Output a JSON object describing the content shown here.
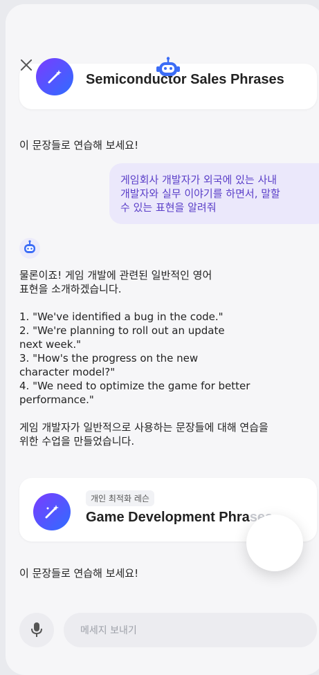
{
  "cards": [
    {
      "title": "Semiconductor Sales Phrases"
    },
    {
      "badge": "개인 최적화 레슨",
      "title_main": "Game Development Phra",
      "title_fade": "ses"
    }
  ],
  "messages": {
    "practice_prompt_1": "이 문장들로 연습해 보세요!",
    "user_message": "게임회사 개발자가 외국에 있는 사내\n개발자와 실무 이야기를 하면서, 말할\n수 있는 표현을 알려줘",
    "bot_reply": "물론이죠! 게임 개발에 관련된 일반적인 영어\n표현을 소개하겠습니다.\n\n1. \"We've identified a bug in the code.\"\n2. \"We're planning to roll out an update\nnext week.\"\n3. \"How's the progress on the new\ncharacter model?\"\n4. \"We need to optimize the game for better\nperformance.\"\n\n게임 개발자가 일반적으로 사용하는 문장들에 대해 연습을\n위한 수업을 만들었습니다.",
    "practice_prompt_2": "이 문장들로 연습해 보세요!"
  },
  "input": {
    "placeholder": "메세지 보내기"
  },
  "colors": {
    "accent": "#5a3ec8",
    "bubble_bg": "#ebe8fb",
    "icon_gradient_start": "#7a3cff",
    "icon_gradient_end": "#2f6dff"
  }
}
